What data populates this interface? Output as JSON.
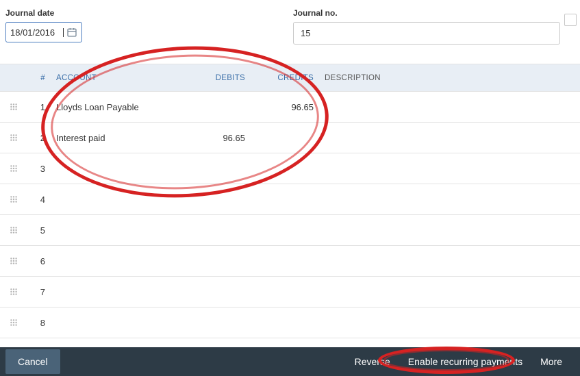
{
  "fields": {
    "journal_date_label": "Journal date",
    "journal_date_value": "18/01/2016",
    "journal_no_label": "Journal no.",
    "journal_no_value": "15"
  },
  "columns": {
    "num": "#",
    "account": "ACCOUNT",
    "debits": "DEBITS",
    "credits": "CREDITS",
    "description": "DESCRIPTION"
  },
  "rows": [
    {
      "num": "1",
      "account": "Lloyds Loan Payable",
      "debits": "",
      "credits": "96.65",
      "description": ""
    },
    {
      "num": "2",
      "account": "Interest paid",
      "debits": "96.65",
      "credits": "",
      "description": ""
    },
    {
      "num": "3",
      "account": "",
      "debits": "",
      "credits": "",
      "description": ""
    },
    {
      "num": "4",
      "account": "",
      "debits": "",
      "credits": "",
      "description": ""
    },
    {
      "num": "5",
      "account": "",
      "debits": "",
      "credits": "",
      "description": ""
    },
    {
      "num": "6",
      "account": "",
      "debits": "",
      "credits": "",
      "description": ""
    },
    {
      "num": "7",
      "account": "",
      "debits": "",
      "credits": "",
      "description": ""
    },
    {
      "num": "8",
      "account": "",
      "debits": "",
      "credits": "",
      "description": ""
    }
  ],
  "footer": {
    "cancel": "Cancel",
    "reverse": "Reverse",
    "enable_recurring": "Enable recurring payments",
    "more": "More"
  }
}
